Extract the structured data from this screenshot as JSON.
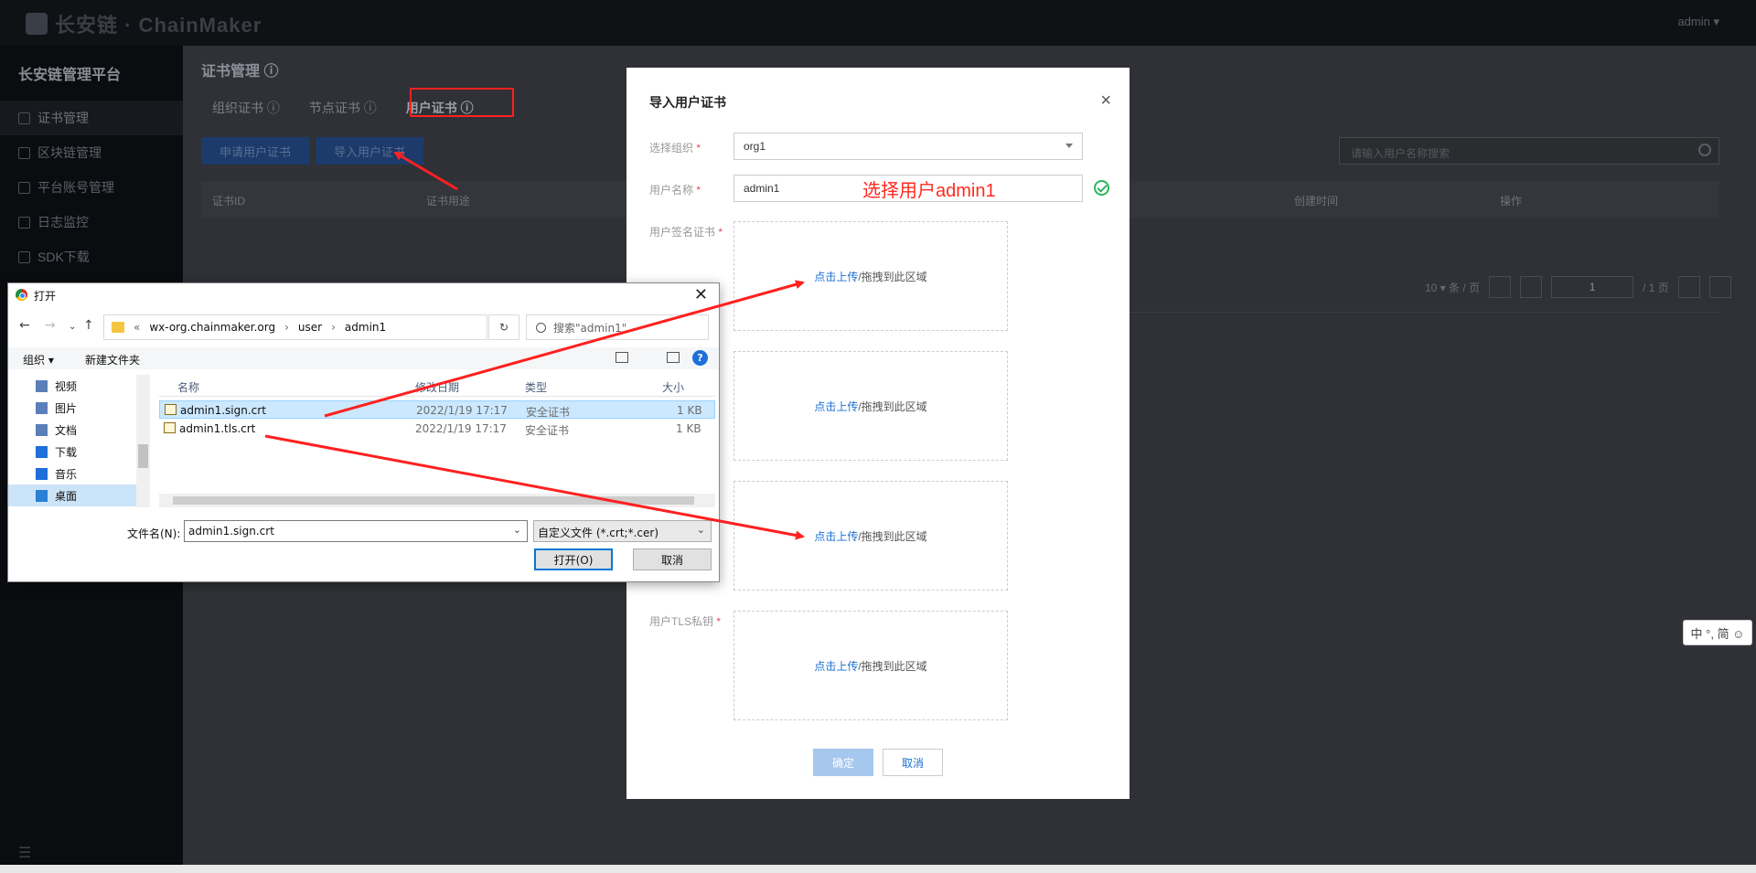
{
  "app": {
    "logo_text": "长安链 · ChainMaker",
    "user": "admin ▾",
    "platform_title": "长安链管理平台"
  },
  "sidebar": {
    "items": [
      {
        "label": "证书管理"
      },
      {
        "label": "区块链管理"
      },
      {
        "label": "平台账号管理"
      },
      {
        "label": "日志监控"
      },
      {
        "label": "SDK下载"
      }
    ]
  },
  "page": {
    "title": "证书管理 ⓘ",
    "tabs": [
      {
        "label": "组织证书 ⓘ"
      },
      {
        "label": "节点证书 ⓘ"
      },
      {
        "label": "用户证书 ⓘ"
      }
    ],
    "buttons": {
      "apply": "申请用户证书",
      "import": "导入用户证书"
    },
    "search_placeholder": "请输入用户名称搜索",
    "table_headers": [
      "证书ID",
      "证书用途",
      "创建时间",
      "操作"
    ],
    "pager": {
      "page_size": "10 ▾ 条 / 页",
      "current": "1",
      "total": "/ 1 页"
    }
  },
  "modal": {
    "title": "导入用户证书",
    "close": "×",
    "org_label": "选择组织",
    "org_value": "org1",
    "user_label": "用户名称",
    "user_value": "admin1",
    "annotation": "选择用户admin1",
    "sign_cert_label": "用户签名证书",
    "tls_key_label": "用户TLS私钥",
    "required": "*",
    "upload_link": "点击上传",
    "upload_text": "/拖拽到此区域",
    "ok": "确定",
    "cancel": "取消"
  },
  "dialog": {
    "title": "打开",
    "close": "✕",
    "path": [
      "«",
      "wx-org.chainmaker.org",
      "›",
      "user",
      "›",
      "admin1"
    ],
    "search_placeholder": "搜索\"admin1\"",
    "toolbar": {
      "organize": "组织 ▾",
      "new_folder": "新建文件夹",
      "help": "?"
    },
    "tree": [
      {
        "label": "视频"
      },
      {
        "label": "图片"
      },
      {
        "label": "文档"
      },
      {
        "label": "下载"
      },
      {
        "label": "音乐"
      },
      {
        "label": "桌面"
      }
    ],
    "columns": [
      "名称",
      "修改日期",
      "类型",
      "大小"
    ],
    "files": [
      {
        "name": "admin1.sign.crt",
        "date": "2022/1/19 17:17",
        "type": "安全证书",
        "size": "1 KB"
      },
      {
        "name": "admin1.tls.crt",
        "date": "2022/1/19 17:17",
        "type": "安全证书",
        "size": "1 KB"
      }
    ],
    "filename_label": "文件名(N):",
    "filename_value": "admin1.sign.crt",
    "filetype_value": "自定义文件 (*.crt;*.cer)",
    "open": "打开(O)",
    "cancel": "取消"
  },
  "ime": {
    "text": "中 °, 简 ☺"
  },
  "colors": {
    "annotation_red": "#ff2a1f",
    "link_blue": "#1a6fd6",
    "ok_disabled": "#a6c7ee"
  }
}
